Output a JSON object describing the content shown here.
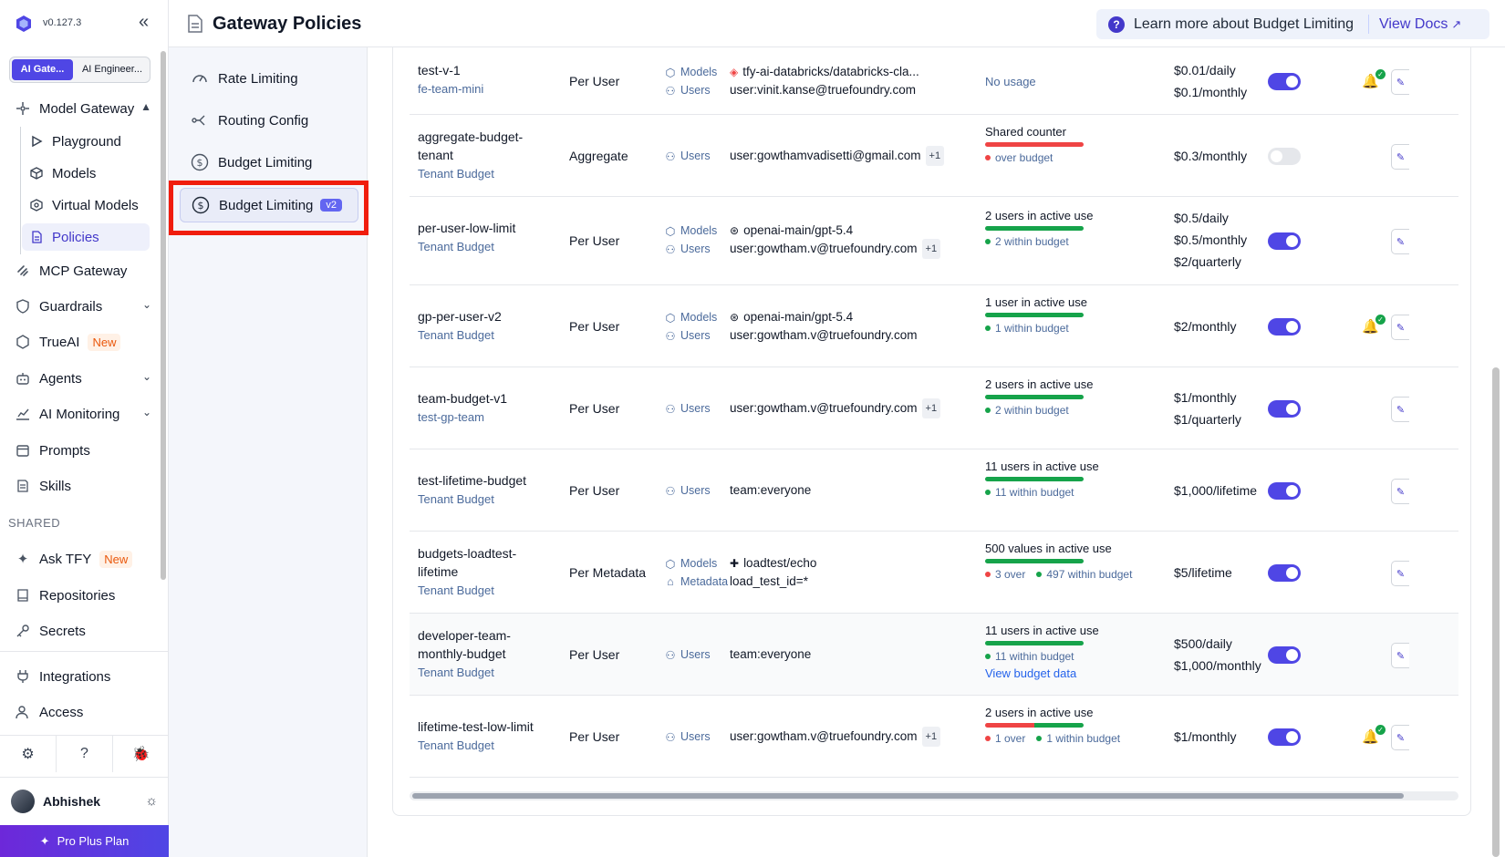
{
  "app": {
    "version": "v0.127.3"
  },
  "workspaces": [
    "AI Gate...",
    "AI Engineer..."
  ],
  "sidebar": {
    "model_gateway": "Model Gateway",
    "sub_items": [
      "Playground",
      "Models",
      "Virtual Models",
      "Policies"
    ],
    "items": {
      "mcp_gateway": "MCP Gateway",
      "guardrails": "Guardrails",
      "trueai": "TrueAI",
      "agents": "Agents",
      "ai_monitoring": "AI Monitoring",
      "prompts": "Prompts",
      "skills": "Skills"
    },
    "new_badge": "New",
    "shared_label": "SHARED",
    "shared_items": {
      "ask_tfy": "Ask TFY",
      "repositories": "Repositories",
      "secrets": "Secrets"
    },
    "bottom_items": {
      "integrations": "Integrations",
      "access": "Access"
    },
    "user_name": "Abhishek",
    "plan": "Pro Plus Plan"
  },
  "header": {
    "title": "Gateway Policies",
    "learn_more": "Learn more about Budget Limiting",
    "view_docs": "View Docs"
  },
  "subnav": {
    "items": [
      "Rate Limiting",
      "Routing Config",
      "Budget Limiting",
      "Budget Limiting"
    ],
    "v2_badge": "v2"
  },
  "labels": {
    "models": "Models",
    "users": "Users",
    "metadata": "Metadata",
    "plus_one": "+1"
  },
  "policies": [
    {
      "name": "test-v-1",
      "team": "fe-team-mini",
      "type": "Per User",
      "model": "tfy-ai-databricks/databricks-cla...",
      "user": "user:vinit.kanse@truefoundry.com",
      "usage": "No usage",
      "limits": [
        "$0.01/daily",
        "$0.1/monthly"
      ],
      "enabled": true,
      "alert": true
    },
    {
      "name": "aggregate-budget-tenant",
      "team": "Tenant Budget",
      "type": "Aggregate",
      "user": "user:gowthamvadisetti@gmail.com",
      "usage_title": "Shared counter",
      "legend_red": "over budget",
      "limits": [
        "$0.3/monthly"
      ],
      "enabled": false,
      "alert": false
    },
    {
      "name": "per-user-low-limit",
      "team": "Tenant Budget",
      "type": "Per User",
      "model": "openai-main/gpt-5.4",
      "user": "user:gowtham.v@truefoundry.com",
      "usage_title": "2 users in active use",
      "legend_green": "2 within budget",
      "limits": [
        "$0.5/daily",
        "$0.5/monthly",
        "$2/quarterly"
      ],
      "enabled": true,
      "alert": false
    },
    {
      "name": "gp-per-user-v2",
      "team": "Tenant Budget",
      "type": "Per User",
      "model": "openai-main/gpt-5.4",
      "user": "user:gowtham.v@truefoundry.com",
      "usage_title": "1 user in active use",
      "legend_green": "1 within budget",
      "limits": [
        "$2/monthly"
      ],
      "enabled": true,
      "alert": true
    },
    {
      "name": "team-budget-v1",
      "team": "test-gp-team",
      "type": "Per User",
      "user": "user:gowtham.v@truefoundry.com",
      "usage_title": "2 users in active use",
      "legend_green": "2 within budget",
      "limits": [
        "$1/monthly",
        "$1/quarterly"
      ],
      "enabled": true,
      "alert": false
    },
    {
      "name": "test-lifetime-budget",
      "team": "Tenant Budget",
      "type": "Per User",
      "user": "team:everyone",
      "usage_title": "11 users in active use",
      "legend_green": "11 within budget",
      "limits": [
        "$1,000/lifetime"
      ],
      "enabled": true,
      "alert": false
    },
    {
      "name": "budgets-loadtest-lifetime",
      "team": "Tenant Budget",
      "type": "Per Metadata",
      "model": "loadtest/echo",
      "metadata": "load_test_id=*",
      "usage_title": "500 values in active use",
      "legend_red": "3 over",
      "legend_green": "497 within budget",
      "limits": [
        "$5/lifetime"
      ],
      "enabled": true,
      "alert": false
    },
    {
      "name": "developer-team-monthly-budget",
      "team": "Tenant Budget",
      "type": "Per User",
      "user": "team:everyone",
      "usage_title": "11 users in active use",
      "legend_green": "11 within budget",
      "link": "View budget data",
      "limits": [
        "$500/daily",
        "$1,000/monthly"
      ],
      "enabled": true,
      "alert": false
    },
    {
      "name": "lifetime-test-low-limit",
      "team": "Tenant Budget",
      "type": "Per User",
      "user": "user:gowtham.v@truefoundry.com",
      "usage_title": "2 users in active use",
      "legend_red": "1 over",
      "legend_green": "1 within budget",
      "limits": [
        "$1/monthly"
      ],
      "enabled": true,
      "alert": true
    }
  ]
}
